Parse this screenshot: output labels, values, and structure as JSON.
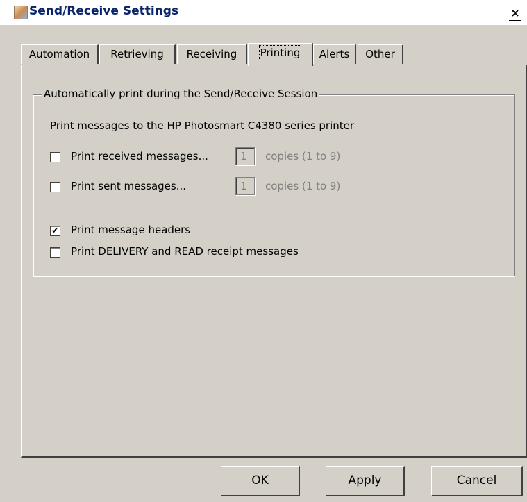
{
  "window": {
    "title": "Send/Receive Settings",
    "close_glyph": "✕"
  },
  "icons": {
    "app_icon": "app-logo-icon",
    "close_icon": "close-icon"
  },
  "tabs": [
    {
      "label": "Automation",
      "active": false
    },
    {
      "label": "Retrieving",
      "active": false
    },
    {
      "label": "Receiving",
      "active": false
    },
    {
      "label": "Printing",
      "active": true
    },
    {
      "label": "Alerts",
      "active": false
    },
    {
      "label": "Other",
      "active": false
    }
  ],
  "printing": {
    "group_title": "Automatically print during the Send/Receive Session",
    "printer_line": "Print messages to the HP Photosmart C4380 series printer",
    "received": {
      "label": "Print received messages...",
      "checked": false,
      "copies": "1",
      "hint": "copies (1 to 9)"
    },
    "sent": {
      "label": "Print sent messages...",
      "checked": false,
      "copies": "1",
      "hint": "copies (1 to 9)"
    },
    "headers": {
      "label": "Print message headers",
      "checked": true,
      "mark": "✔"
    },
    "receipts": {
      "label": "Print DELIVERY and READ receipt messages",
      "checked": false
    }
  },
  "buttons": {
    "ok": "OK",
    "apply": "Apply",
    "cancel": "Cancel"
  }
}
